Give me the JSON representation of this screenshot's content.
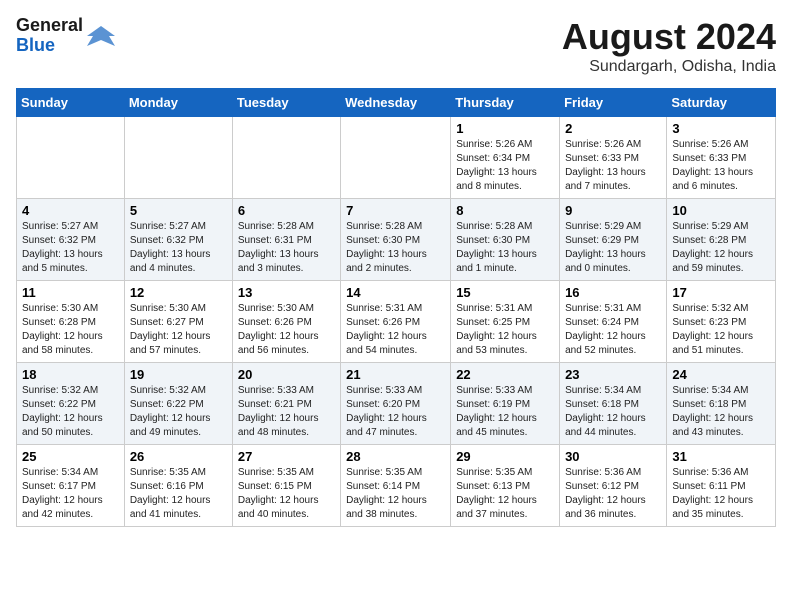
{
  "logo": {
    "line1": "General",
    "line2": "Blue"
  },
  "title": "August 2024",
  "subtitle": "Sundargarh, Odisha, India",
  "headers": [
    "Sunday",
    "Monday",
    "Tuesday",
    "Wednesday",
    "Thursday",
    "Friday",
    "Saturday"
  ],
  "weeks": [
    [
      {
        "day": "",
        "info": ""
      },
      {
        "day": "",
        "info": ""
      },
      {
        "day": "",
        "info": ""
      },
      {
        "day": "",
        "info": ""
      },
      {
        "day": "1",
        "info": "Sunrise: 5:26 AM\nSunset: 6:34 PM\nDaylight: 13 hours\nand 8 minutes."
      },
      {
        "day": "2",
        "info": "Sunrise: 5:26 AM\nSunset: 6:33 PM\nDaylight: 13 hours\nand 7 minutes."
      },
      {
        "day": "3",
        "info": "Sunrise: 5:26 AM\nSunset: 6:33 PM\nDaylight: 13 hours\nand 6 minutes."
      }
    ],
    [
      {
        "day": "4",
        "info": "Sunrise: 5:27 AM\nSunset: 6:32 PM\nDaylight: 13 hours\nand 5 minutes."
      },
      {
        "day": "5",
        "info": "Sunrise: 5:27 AM\nSunset: 6:32 PM\nDaylight: 13 hours\nand 4 minutes."
      },
      {
        "day": "6",
        "info": "Sunrise: 5:28 AM\nSunset: 6:31 PM\nDaylight: 13 hours\nand 3 minutes."
      },
      {
        "day": "7",
        "info": "Sunrise: 5:28 AM\nSunset: 6:30 PM\nDaylight: 13 hours\nand 2 minutes."
      },
      {
        "day": "8",
        "info": "Sunrise: 5:28 AM\nSunset: 6:30 PM\nDaylight: 13 hours\nand 1 minute."
      },
      {
        "day": "9",
        "info": "Sunrise: 5:29 AM\nSunset: 6:29 PM\nDaylight: 13 hours\nand 0 minutes."
      },
      {
        "day": "10",
        "info": "Sunrise: 5:29 AM\nSunset: 6:28 PM\nDaylight: 12 hours\nand 59 minutes."
      }
    ],
    [
      {
        "day": "11",
        "info": "Sunrise: 5:30 AM\nSunset: 6:28 PM\nDaylight: 12 hours\nand 58 minutes."
      },
      {
        "day": "12",
        "info": "Sunrise: 5:30 AM\nSunset: 6:27 PM\nDaylight: 12 hours\nand 57 minutes."
      },
      {
        "day": "13",
        "info": "Sunrise: 5:30 AM\nSunset: 6:26 PM\nDaylight: 12 hours\nand 56 minutes."
      },
      {
        "day": "14",
        "info": "Sunrise: 5:31 AM\nSunset: 6:26 PM\nDaylight: 12 hours\nand 54 minutes."
      },
      {
        "day": "15",
        "info": "Sunrise: 5:31 AM\nSunset: 6:25 PM\nDaylight: 12 hours\nand 53 minutes."
      },
      {
        "day": "16",
        "info": "Sunrise: 5:31 AM\nSunset: 6:24 PM\nDaylight: 12 hours\nand 52 minutes."
      },
      {
        "day": "17",
        "info": "Sunrise: 5:32 AM\nSunset: 6:23 PM\nDaylight: 12 hours\nand 51 minutes."
      }
    ],
    [
      {
        "day": "18",
        "info": "Sunrise: 5:32 AM\nSunset: 6:22 PM\nDaylight: 12 hours\nand 50 minutes."
      },
      {
        "day": "19",
        "info": "Sunrise: 5:32 AM\nSunset: 6:22 PM\nDaylight: 12 hours\nand 49 minutes."
      },
      {
        "day": "20",
        "info": "Sunrise: 5:33 AM\nSunset: 6:21 PM\nDaylight: 12 hours\nand 48 minutes."
      },
      {
        "day": "21",
        "info": "Sunrise: 5:33 AM\nSunset: 6:20 PM\nDaylight: 12 hours\nand 47 minutes."
      },
      {
        "day": "22",
        "info": "Sunrise: 5:33 AM\nSunset: 6:19 PM\nDaylight: 12 hours\nand 45 minutes."
      },
      {
        "day": "23",
        "info": "Sunrise: 5:34 AM\nSunset: 6:18 PM\nDaylight: 12 hours\nand 44 minutes."
      },
      {
        "day": "24",
        "info": "Sunrise: 5:34 AM\nSunset: 6:18 PM\nDaylight: 12 hours\nand 43 minutes."
      }
    ],
    [
      {
        "day": "25",
        "info": "Sunrise: 5:34 AM\nSunset: 6:17 PM\nDaylight: 12 hours\nand 42 minutes."
      },
      {
        "day": "26",
        "info": "Sunrise: 5:35 AM\nSunset: 6:16 PM\nDaylight: 12 hours\nand 41 minutes."
      },
      {
        "day": "27",
        "info": "Sunrise: 5:35 AM\nSunset: 6:15 PM\nDaylight: 12 hours\nand 40 minutes."
      },
      {
        "day": "28",
        "info": "Sunrise: 5:35 AM\nSunset: 6:14 PM\nDaylight: 12 hours\nand 38 minutes."
      },
      {
        "day": "29",
        "info": "Sunrise: 5:35 AM\nSunset: 6:13 PM\nDaylight: 12 hours\nand 37 minutes."
      },
      {
        "day": "30",
        "info": "Sunrise: 5:36 AM\nSunset: 6:12 PM\nDaylight: 12 hours\nand 36 minutes."
      },
      {
        "day": "31",
        "info": "Sunrise: 5:36 AM\nSunset: 6:11 PM\nDaylight: 12 hours\nand 35 minutes."
      }
    ]
  ]
}
